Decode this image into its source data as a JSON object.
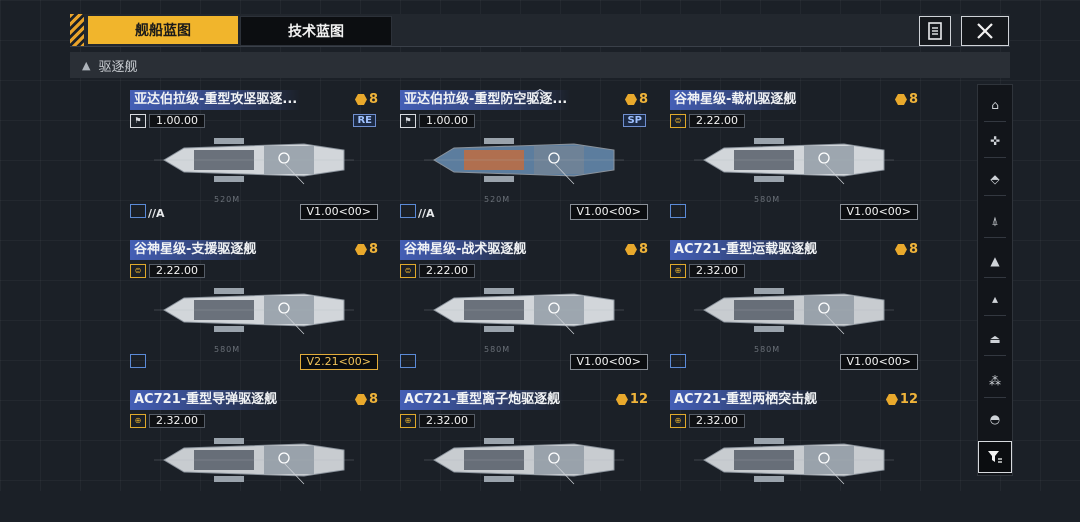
{
  "tabs": [
    {
      "label": "舰船蓝图",
      "active": true
    },
    {
      "label": "技术蓝图",
      "active": false
    }
  ],
  "category": "驱逐舰",
  "cards": [
    {
      "title": "亚达伯拉级-重型攻坚驱逐...",
      "cost": "8",
      "version": "1.00.00",
      "tag": "RE",
      "grade": "//A",
      "model": "V1.00<00>",
      "model_gold": false,
      "dim": "520M"
    },
    {
      "title": "亚达伯拉级-重型防空驱逐...",
      "cost": "8",
      "version": "1.00.00",
      "tag": "SP",
      "grade": "//A",
      "model": "V1.00<00>",
      "model_gold": false,
      "dim": "520M"
    },
    {
      "title": "谷神星级-载机驱逐舰",
      "cost": "8",
      "version": "2.22.00",
      "tag": "",
      "grade": "",
      "model": "V1.00<00>",
      "model_gold": false,
      "dim": "580M"
    },
    {
      "title": "谷神星级-支援驱逐舰",
      "cost": "8",
      "version": "2.22.00",
      "tag": "",
      "grade": "",
      "model": "V2.21<00>",
      "model_gold": true,
      "dim": "580M"
    },
    {
      "title": "谷神星级-战术驱逐舰",
      "cost": "8",
      "version": "2.22.00",
      "tag": "",
      "grade": "",
      "model": "V1.00<00>",
      "model_gold": false,
      "dim": "580M"
    },
    {
      "title": "AC721-重型运载驱逐舰",
      "cost": "8",
      "version": "2.32.00",
      "tag": "",
      "grade": "",
      "model": "V1.00<00>",
      "model_gold": false,
      "dim": "580M"
    },
    {
      "title": "AC721-重型导弹驱逐舰",
      "cost": "8",
      "version": "2.32.00",
      "tag": "",
      "grade": "",
      "model": "",
      "model_gold": false,
      "dim": ""
    },
    {
      "title": "AC721-重型离子炮驱逐舰",
      "cost": "12",
      "version": "2.32.00",
      "tag": "",
      "grade": "",
      "model": "",
      "model_gold": false,
      "dim": ""
    },
    {
      "title": "AC721-重型两栖突击舰",
      "cost": "12",
      "version": "2.32.00",
      "tag": "",
      "grade": "",
      "model": "",
      "model_gold": false,
      "dim": ""
    }
  ]
}
